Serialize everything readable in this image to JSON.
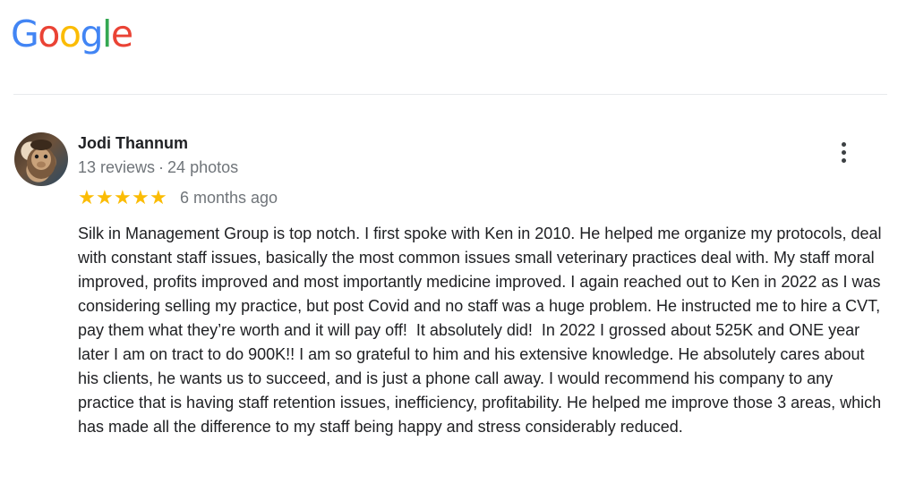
{
  "brand": {
    "logo_letters": [
      {
        "ch": "G",
        "color": "#4285F4"
      },
      {
        "ch": "o",
        "color": "#EA4335"
      },
      {
        "ch": "o",
        "color": "#FBBC05"
      },
      {
        "ch": "g",
        "color": "#4285F4"
      },
      {
        "ch": "l",
        "color": "#34A853"
      },
      {
        "ch": "e",
        "color": "#EA4335"
      }
    ]
  },
  "review": {
    "reviewer_name": "Jodi Thannum",
    "reviews_count": "13 reviews",
    "separator": "·",
    "photos_count": "24 photos",
    "rating": 5,
    "star_glyph": "★",
    "star_color": "#FBBC04",
    "time_ago": "6 months ago",
    "more_icon": "more-vert-icon",
    "text": "Silk in Management Group is top notch. I first spoke with Ken in 2010. He helped me organize my protocols, deal with constant staff issues, basically the most common issues small veterinary practices deal with. My staff moral improved, profits improved and most importantly medicine improved. I again reached out to Ken in 2022 as I was considering selling my practice, but post Covid and no staff was a huge problem. He instructed me to hire a CVT, pay them what they’re worth and it will pay off!  It absolutely did!  In 2022 I grossed about 525K and ONE year later I am on tract to do 900K!! I am so grateful to him and his extensive knowledge. He absolutely cares about his clients, he wants us to succeed, and is just a phone call away. I would recommend his company to any practice that is having staff retention issues, inefficiency, profitability. He helped me improve those 3 areas, which has made all the difference to my staff being happy and stress considerably reduced."
  }
}
